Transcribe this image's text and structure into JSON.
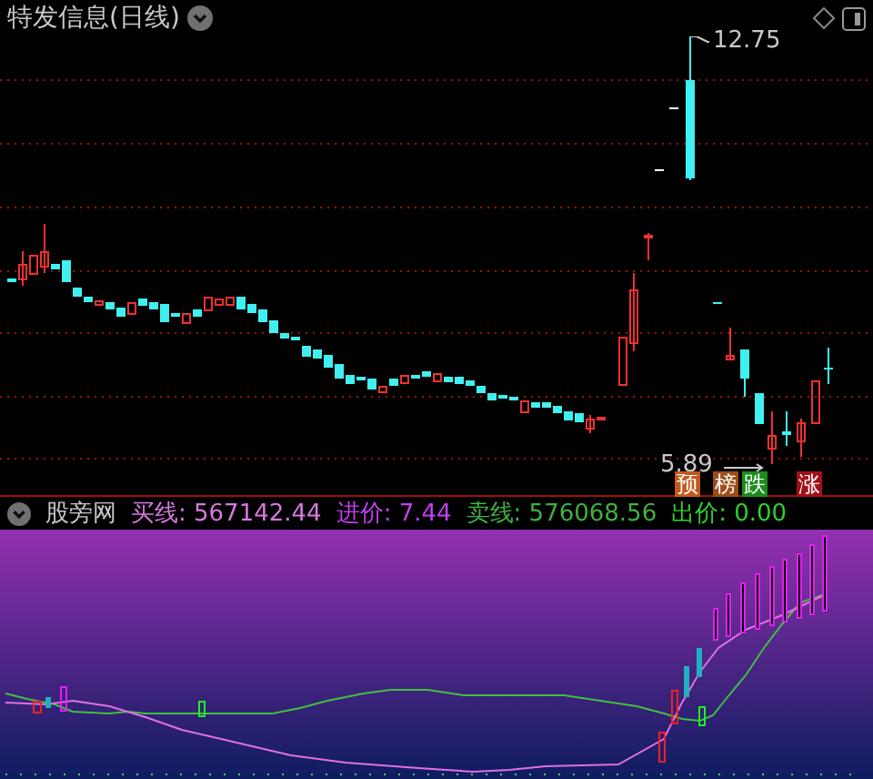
{
  "header": {
    "title": "特发信息(日线)"
  },
  "price_chart": {
    "high_label": "12.75",
    "low_label": "5.89",
    "signals": [
      {
        "label": "预",
        "color": "#c4581c"
      },
      {
        "label": "榜",
        "color": "#9c4c18"
      },
      {
        "label": "跌",
        "color": "#1c8c1c"
      },
      {
        "label": "涨",
        "color": "#a01018"
      }
    ]
  },
  "indicator": {
    "name": "股旁网",
    "values": [
      {
        "label": "买线: 567142.44"
      },
      {
        "label": "进价: 7.44"
      },
      {
        "label": "卖线: 576068.56"
      },
      {
        "label": "出价: 0.00"
      }
    ]
  }
}
